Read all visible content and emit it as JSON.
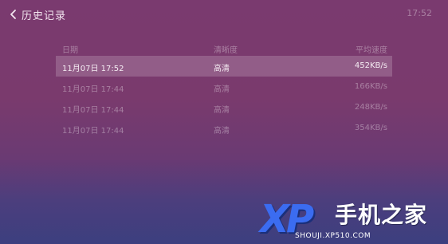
{
  "header": {
    "back_label": "历史记录",
    "time": "17:52"
  },
  "table": {
    "headers": {
      "date": "日期",
      "quality": "清晰度",
      "speed": "平均速度"
    },
    "rows": [
      {
        "date": "11月07日 17:52",
        "quality": "高清",
        "speed": "452KB/s"
      },
      {
        "date": "11月07日 17:44",
        "quality": "高清",
        "speed": "166KB/s"
      },
      {
        "date": "11月07日 17:44",
        "quality": "高清",
        "speed": "248KB/s"
      },
      {
        "date": "11月07日 17:44",
        "quality": "高清",
        "speed": "354KB/s"
      }
    ]
  },
  "watermark": {
    "logo_text": "XP",
    "brand_name": "手机之家",
    "url": "SHOUJI.XP510.COM"
  },
  "colors": {
    "bg_top": "#7a3a6f",
    "bg_bottom": "#3c3f7f",
    "logo_blue": "#3b6cf0"
  }
}
